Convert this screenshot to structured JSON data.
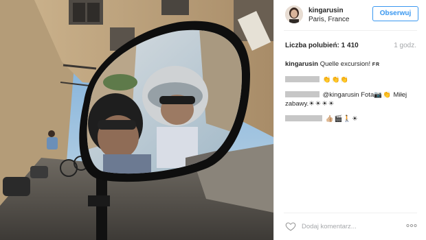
{
  "post": {
    "username": "kingarusin",
    "location": "Paris, France",
    "follow_label": "Obserwuj"
  },
  "stats": {
    "likes_label": "Liczba polubień:",
    "likes_count": "1 410",
    "time": "1 godz."
  },
  "comments": [
    {
      "user": "kingarusin",
      "text": "Quelle excursion!",
      "suffix": "FR"
    },
    {
      "user": "",
      "emoji": "👏👏👏"
    },
    {
      "user": "",
      "text_before": "@kingarusin Fota",
      "emoji_mid": "📷👏",
      "text_after": " Miłej zabawy.",
      "emoji": "☀☀☀☀"
    },
    {
      "user": "",
      "emoji": "👍🏼🎬🚶☀"
    }
  ],
  "footer": {
    "comment_placeholder": "Dodaj komentarz..."
  },
  "icons": {
    "like": "heart-icon",
    "more": "more-options-icon",
    "avatar": "avatar"
  },
  "colors": {
    "accent": "#3897f0",
    "muted": "#a5a7aa",
    "text": "#262626"
  }
}
